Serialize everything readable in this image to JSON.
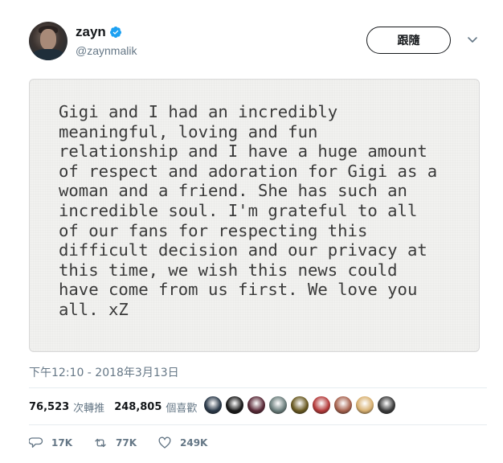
{
  "user": {
    "display_name": "zayn",
    "handle": "@zaynmalik",
    "verified_icon": "verified-badge-icon"
  },
  "follow_button": {
    "label": "跟隨"
  },
  "tweet": {
    "text": "Gigi and I had an incredibly\nmeaningful, loving and fun\nrelationship and I have a huge amount\nof respect and adoration for Gigi as a\nwoman and a friend. She has such an\nincredible soul. I'm grateful to all\nof our fans for respecting this\ndifficult decision and our privacy at\nthis time, we wish this news could\nhave come from us first. We love you\nall. xZ",
    "timestamp": "下午12:10 - 2018年3月13日"
  },
  "stats": {
    "retweets_count": "76,523",
    "retweets_label": "次轉推",
    "likes_count": "248,805",
    "likes_label": "個喜歡"
  },
  "likers": {
    "colors": [
      "#2b3a4a",
      "#1a1a1a",
      "#5a2a38",
      "#6b7e7c",
      "#6a5a22",
      "#b43a3a",
      "#a7624e",
      "#d8b070",
      "#3c3c3c"
    ]
  },
  "actions": {
    "reply_count": "17K",
    "retweet_count": "77K",
    "like_count": "249K"
  },
  "colors": {
    "verified": "#1da1f2",
    "secondary_text": "#657786",
    "primary_text": "#14171a"
  }
}
